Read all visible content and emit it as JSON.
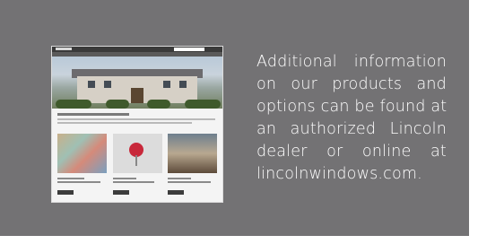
{
  "info": {
    "lines": [
      "Additional information",
      "on our products and",
      "options can be found at",
      "an authorized Lincoln",
      "dealer or online at",
      "lincolnwindows.com."
    ]
  },
  "image": {
    "subject": "website-screenshot-thumbnail"
  },
  "colors": {
    "panel": "#737274",
    "text": "#ffffff"
  }
}
